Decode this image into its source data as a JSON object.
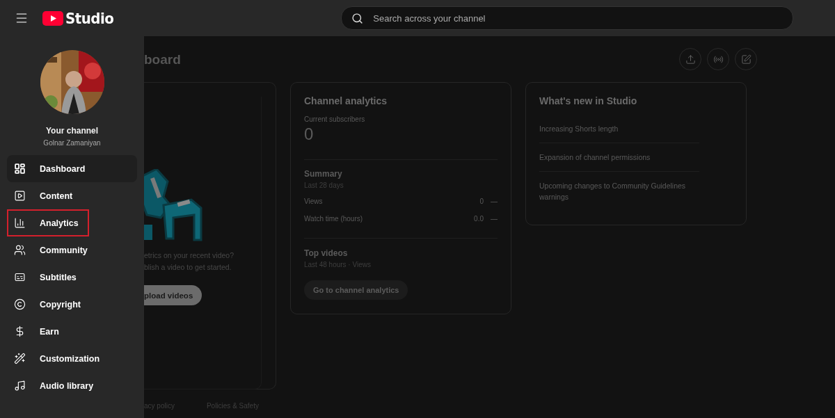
{
  "header": {
    "logo_text": "Studio",
    "search": {
      "placeholder": "Search across your channel"
    }
  },
  "drawer": {
    "channel_label": "Your channel",
    "channel_name": "Golnar Zamaniyan",
    "items": [
      {
        "label": "Dashboard",
        "selected": true,
        "highlighted": false
      },
      {
        "label": "Content",
        "selected": false,
        "highlighted": false
      },
      {
        "label": "Analytics",
        "selected": false,
        "highlighted": true
      },
      {
        "label": "Community",
        "selected": false,
        "highlighted": false
      },
      {
        "label": "Subtitles",
        "selected": false,
        "highlighted": false
      },
      {
        "label": "Copyright",
        "selected": false,
        "highlighted": false
      },
      {
        "label": "Earn",
        "selected": false,
        "highlighted": false
      },
      {
        "label": "Customization",
        "selected": false,
        "highlighted": false
      },
      {
        "label": "Audio library",
        "selected": false,
        "highlighted": false
      }
    ]
  },
  "page": {
    "title": "board",
    "upload_card": {
      "lines": [
        "etrics on your recent video?",
        "blish a video to get started."
      ],
      "button": "pload videos"
    },
    "analytics_card": {
      "title": "Channel analytics",
      "subscribers_label": "Current subscribers",
      "subscribers": "0",
      "summary_title": "Summary",
      "summary_period": "Last 28 days",
      "metrics": [
        {
          "label": "Views",
          "value": "0",
          "trend": "—"
        },
        {
          "label": "Watch time (hours)",
          "value": "0.0",
          "trend": "—"
        }
      ],
      "top_title": "Top videos",
      "top_period": "Last 48 hours · Views",
      "button": "Go to channel analytics"
    },
    "news_card": {
      "title": "What's new in Studio",
      "items": [
        "Increasing Shorts length",
        "Expansion of channel permissions",
        "Upcoming changes to Community Guidelines warnings"
      ]
    },
    "footer_links": [
      "acy policy",
      "Policies & Safety"
    ]
  }
}
